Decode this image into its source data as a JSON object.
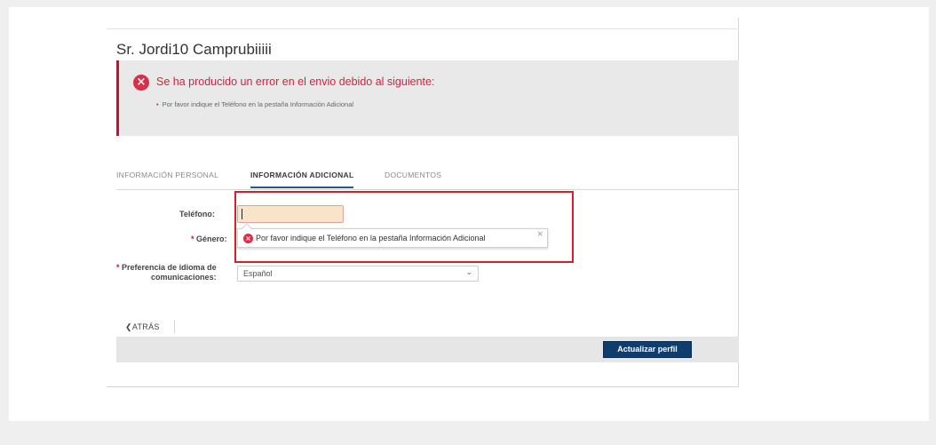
{
  "user": {
    "name": "Sr. Jordi10 Camprubiiiii"
  },
  "error": {
    "icon": "error-x-icon",
    "icon_glyph": "×",
    "title": "Se ha producido un error en el envio debido al siguiente:",
    "items": [
      "Por favor indique el Teléfono en la pestaña Información Adicional"
    ],
    "color": "#d2233f"
  },
  "tabs": [
    {
      "label": "INFORMACIÓN PERSONAL",
      "active": false
    },
    {
      "label": "INFORMACIÓN ADICIONAL",
      "active": true
    },
    {
      "label": "DOCUMENTOS",
      "active": false
    }
  ],
  "form": {
    "phone_label": "Teléfono:",
    "phone_value": "",
    "gender_label": "Género:",
    "language_label_line1": "Preferencia de idioma de",
    "language_label_line2": "comunicaciones:",
    "language_value": "Español",
    "required_mark": "*"
  },
  "tooltip": {
    "icon_glyph": "×",
    "text": "Por favor indique el Teléfono en la pestaña Información Adicional",
    "close": "×"
  },
  "nav": {
    "back_label": "ATRÁS",
    "back_glyph": "❮"
  },
  "actions": {
    "update_label": "Actualizar perfil"
  },
  "colors": {
    "accent": "#0f3e6e",
    "error": "#d2233f",
    "highlight": "#d41f2c"
  }
}
